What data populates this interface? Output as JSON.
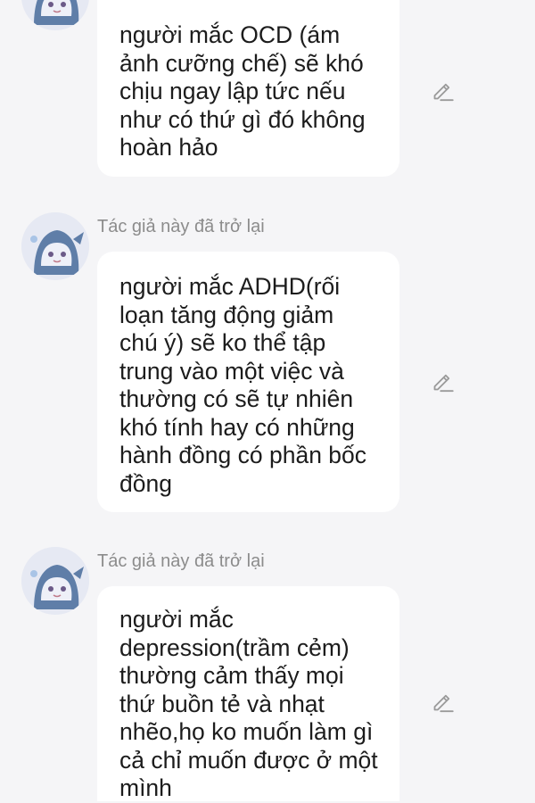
{
  "icons": {
    "avatar": "avatar-icon",
    "edit": "pencil-icon"
  },
  "colors": {
    "background": "#f5f5f7",
    "bubble": "#ffffff",
    "author_text": "#8c8c8c",
    "message_text": "#1c1c1c",
    "icon": "#9a9a9a"
  },
  "messages": [
    {
      "author": "",
      "lines": [
        "người mắc OCD (ám",
        "ảnh cưỡng chế) sẽ khó",
        "chịu ngay lập tức nếu",
        "như có thứ gì đó không",
        "hoàn hảo"
      ]
    },
    {
      "author": "Tác giả này đã trở lại",
      "lines": [
        "người mắc ADHD(rối",
        "loạn tăng động giảm",
        "chú ý) sẽ ko thể tập",
        "trung vào một việc và",
        "thường có sẽ tự nhiên",
        "khó tính hay có những",
        "hành đồng có phần bốc",
        "đồng"
      ]
    },
    {
      "author": "Tác giả này đã trở lại",
      "lines": [
        "người mắc",
        "depression(trầm cẻm)",
        "thường cảm thấy mọi",
        "thứ buồn tẻ và nhạt",
        "nhẽo,họ ko muốn làm gì",
        "cả chỉ muốn được ở một",
        "mình"
      ]
    }
  ]
}
